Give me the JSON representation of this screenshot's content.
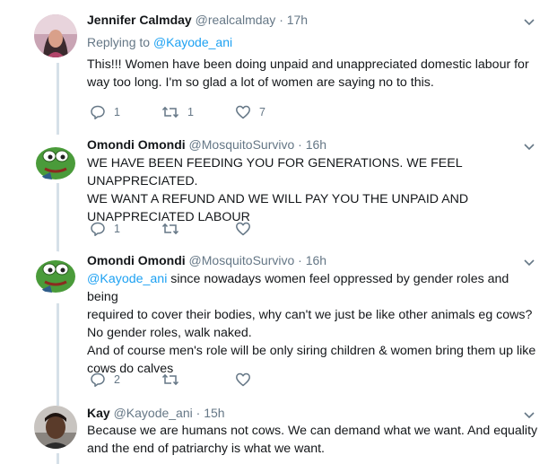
{
  "tweets": [
    {
      "name": "Jennifer Calmday",
      "handle": "@realcalmday",
      "time": "· 17h",
      "replying_label": "Replying to",
      "replying_to": "@Kayode_ani",
      "lines": [
        "This!!! Women have been doing unpaid and unappreciated domestic labour for",
        "way too long. I'm so glad a lot of women are saying no to this."
      ],
      "replies": "1",
      "retweets": "1",
      "likes": "7"
    },
    {
      "name": "Omondi Omondi",
      "handle": "@MosquitoSurvivo",
      "time": "· 16h",
      "lines": [
        "WE HAVE BEEN FEEDING YOU FOR GENERATIONS. WE FEEL UNAPPRECIATED.",
        "WE WANT A REFUND AND WE WILL PAY YOU THE UNPAID AND",
        "UNAPPRECIATED LABOUR"
      ],
      "replies": "1",
      "retweets": "",
      "likes": ""
    },
    {
      "name": "Omondi Omondi",
      "handle": "@MosquitoSurvivo",
      "time": "· 16h",
      "mention": "@Kayode_ani",
      "lines": [
        " since nowadays women feel oppressed by gender roles and being",
        "required to cover their bodies, why can't we just be like other animals eg cows?",
        "No gender roles, walk naked.",
        "And of course men's role will be only siring children & women bring them up like",
        "cows do calves"
      ],
      "replies": "2",
      "retweets": "",
      "likes": ""
    },
    {
      "name": "Kay",
      "handle": "@Kayode_ani",
      "time": "· 15h",
      "lines": [
        "Because we are humans not cows. We can demand what we want. And equality",
        "and the end of patriarchy is what we want."
      ]
    }
  ],
  "icons": {
    "reply": "reply-icon",
    "retweet": "retweet-icon",
    "like": "heart-icon",
    "more": "chevron-down-icon"
  },
  "colors": {
    "link": "#1da1f2",
    "muted": "#657786",
    "thread_line": "#d6e0e8"
  }
}
